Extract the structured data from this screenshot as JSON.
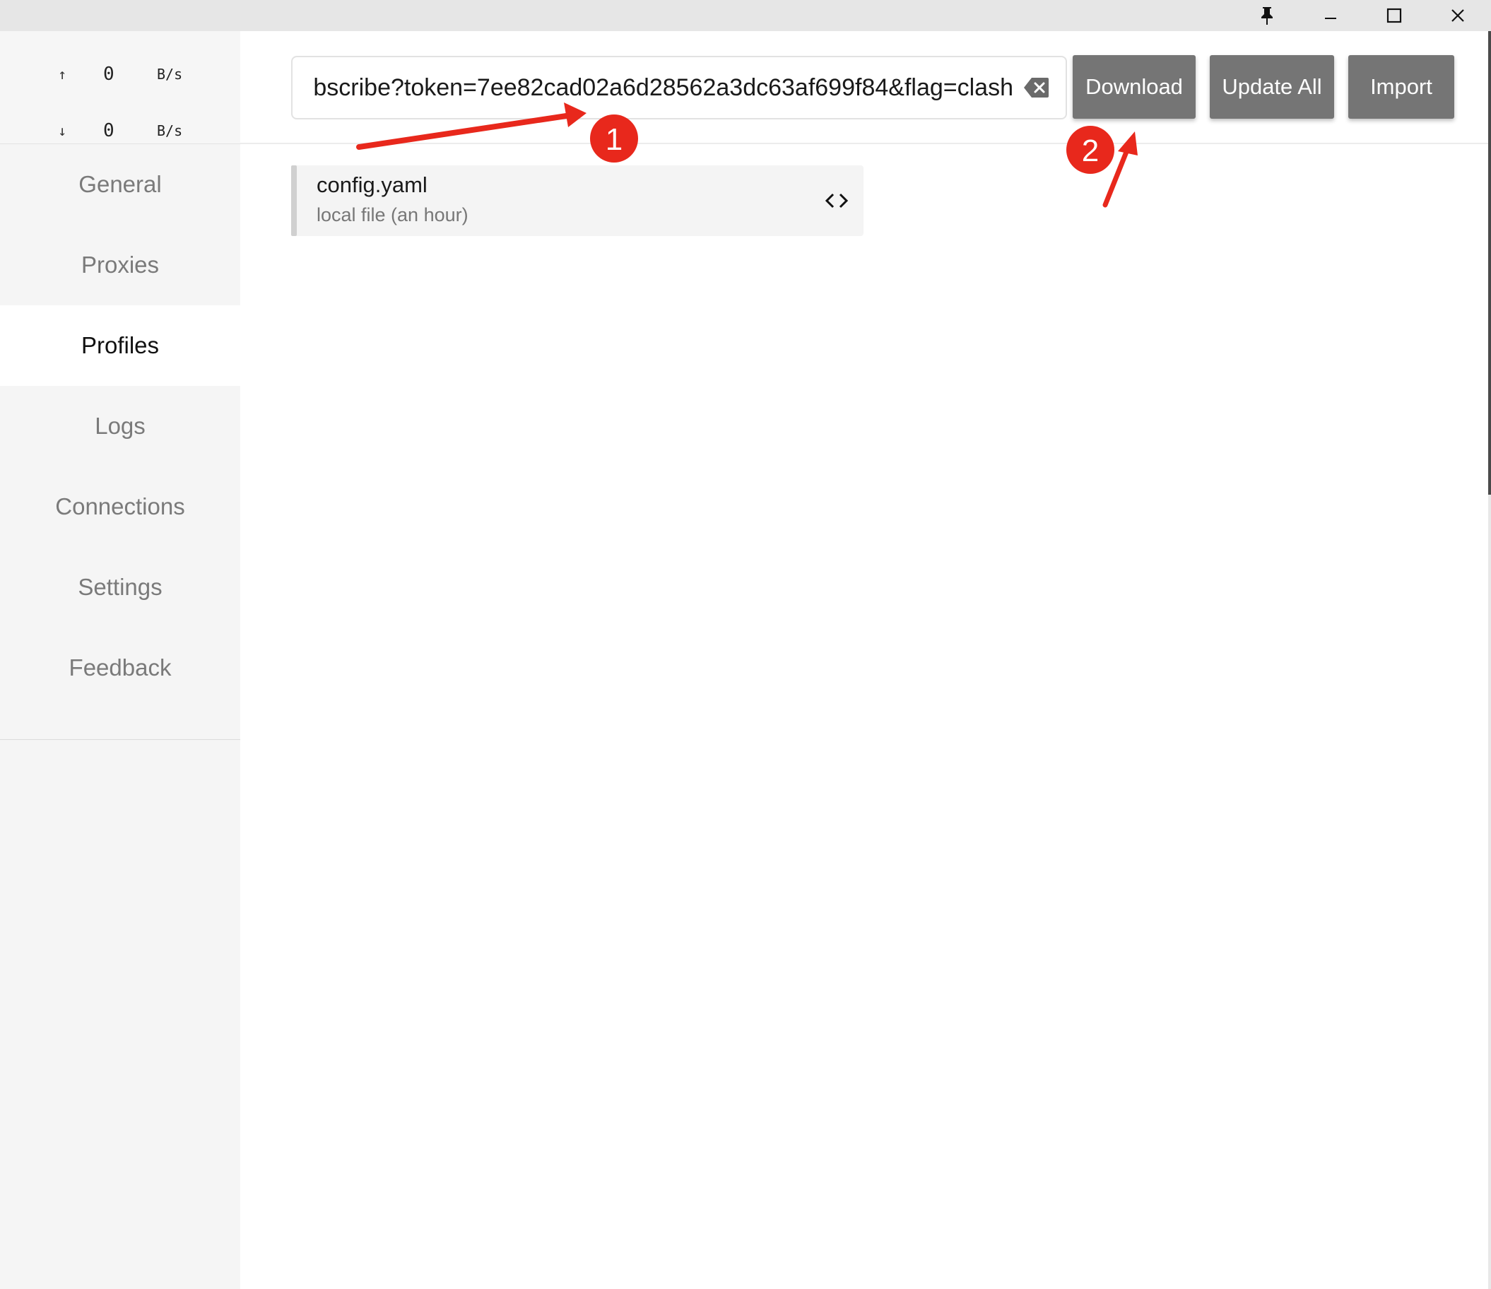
{
  "titlebar": {
    "pin_icon": "pin-icon",
    "minimize_icon": "minimize-icon",
    "maximize_icon": "maximize-icon",
    "close_icon": "close-icon"
  },
  "traffic": {
    "upload": {
      "arrow": "↑",
      "value": "0",
      "unit": "B/s"
    },
    "download": {
      "arrow": "↓",
      "value": "0",
      "unit": "B/s"
    }
  },
  "sidebar": {
    "items": [
      {
        "label": "General"
      },
      {
        "label": "Proxies"
      },
      {
        "label": "Profiles",
        "active": true
      },
      {
        "label": "Logs"
      },
      {
        "label": "Connections"
      },
      {
        "label": "Settings"
      },
      {
        "label": "Feedback"
      }
    ]
  },
  "url_input": {
    "value": "bscribe?token=7ee82cad02a6d28562a3dc63af699f84&flag=clash",
    "clear_icon": "backspace-clear-icon"
  },
  "toolbar": {
    "download_label": "Download",
    "update_all_label": "Update All",
    "import_label": "Import"
  },
  "profiles": [
    {
      "name": "config.yaml",
      "subtitle": "local file (an hour)",
      "action_icon": "code-icon"
    }
  ],
  "annotations": {
    "badge_1": "1",
    "badge_2": "2",
    "color": "#e8281c"
  }
}
